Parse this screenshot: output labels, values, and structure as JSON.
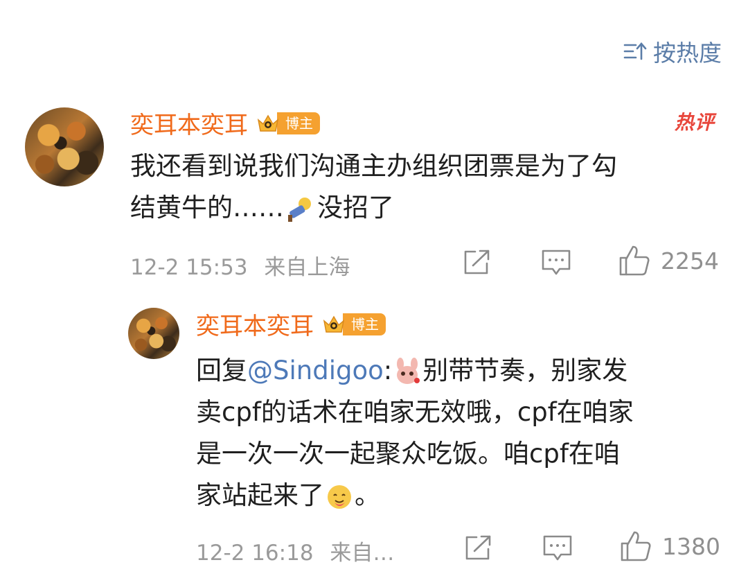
{
  "sort": {
    "label": "按热度"
  },
  "comments": [
    {
      "username": "奕耳本奕耳",
      "badge": "博主",
      "hot_label": "热评",
      "text_lines": [
        "我还看到说我们沟通主办组织团票是为了勾",
        "结黄牛的……",
        "没招了"
      ],
      "time": "12-2 15:53",
      "location": "来自上海",
      "likes": "2254"
    },
    {
      "username": "奕耳本奕耳",
      "badge": "博主",
      "reply_prefix": "回复",
      "mention": "@Sindigoo",
      "colon": ":",
      "text_lines": [
        "别带节奏，别家发",
        "卖cpf的话术在咱家无效哦，cpf在咱家",
        "是一次一次一起聚众吃饭。咱cpf在咱",
        "家站起来了",
        "。"
      ],
      "time": "12-2 16:18",
      "location": "来自…",
      "likes": "1380"
    }
  ],
  "icons": [
    "sort-icon",
    "crown-icon",
    "share-icon",
    "comment-icon",
    "like-icon"
  ],
  "colors": {
    "username": "#f06a1b",
    "mention": "#4d79b8",
    "hot": "#e8473c",
    "badge": "#f5a130",
    "meta": "#9a9a9a"
  }
}
